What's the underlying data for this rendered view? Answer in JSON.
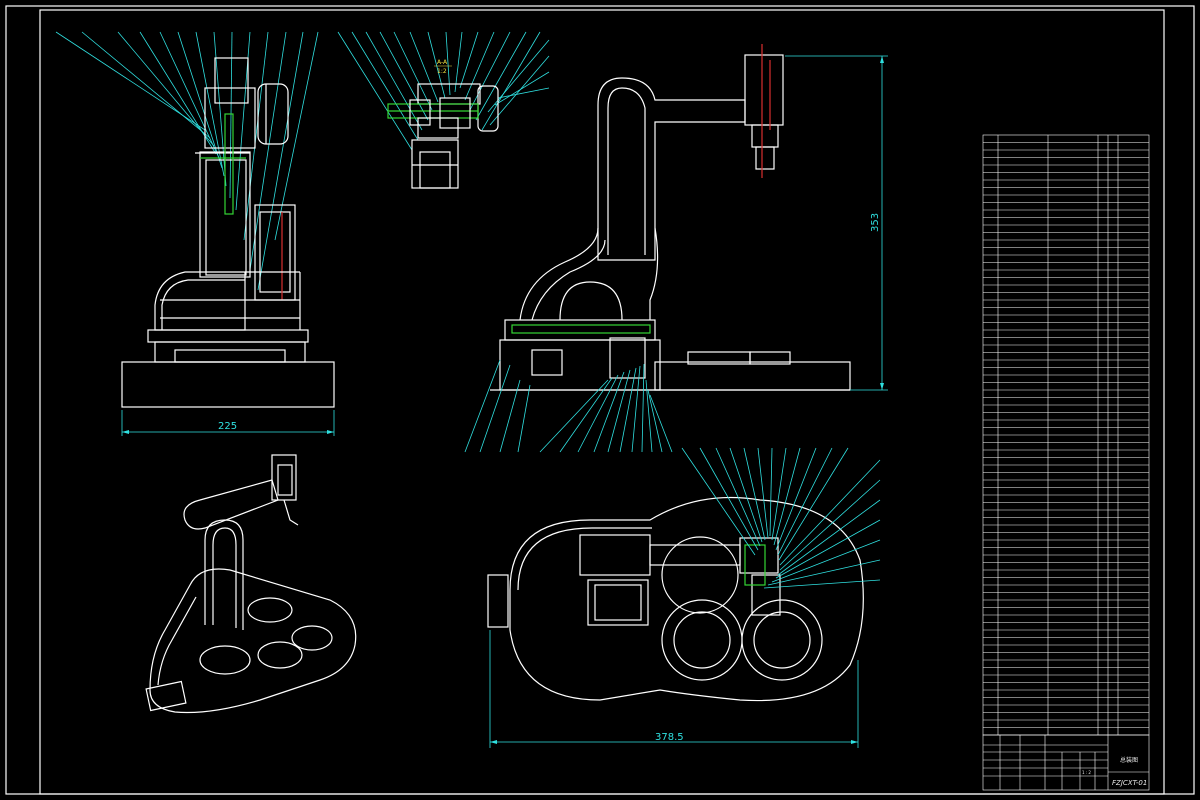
{
  "drawing": {
    "colors": {
      "background": "#000000",
      "outline": "#ffffff",
      "leader": "#2fe0e0",
      "section": "#34d534",
      "axis": "#d83030"
    },
    "dimensions": {
      "front_width": "225",
      "side_height": "353",
      "top_width": "378.5"
    },
    "section_label": "A-A",
    "section_scale": "1:2"
  },
  "title_block": {
    "title": "总装图",
    "drawing_number": "FZJCXT-01",
    "sheet_info": "1 : 2"
  }
}
